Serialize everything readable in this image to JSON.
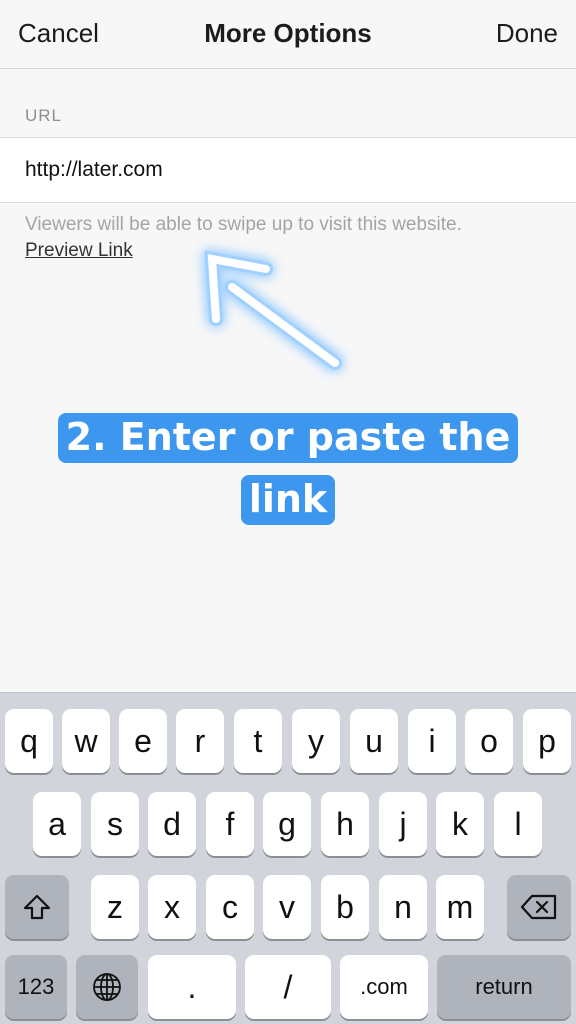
{
  "navbar": {
    "cancel_label": "Cancel",
    "title": "More Options",
    "done_label": "Done"
  },
  "url_section": {
    "header": "URL",
    "value": "http://later.com",
    "footnote": "Viewers will be able to swipe up to visit this website.",
    "preview_link": "Preview Link"
  },
  "overlay": {
    "caption_line1": "2. Enter or paste the",
    "caption_line2": "link",
    "caption_color": "#3d97ee",
    "arrow_icon": "glowing-arrow-icon"
  },
  "keyboard": {
    "row1": [
      "q",
      "w",
      "e",
      "r",
      "t",
      "y",
      "u",
      "i",
      "o",
      "p"
    ],
    "row2": [
      "a",
      "s",
      "d",
      "f",
      "g",
      "h",
      "j",
      "k",
      "l"
    ],
    "row3": [
      "z",
      "x",
      "c",
      "v",
      "b",
      "n",
      "m"
    ],
    "numbers_label": "123",
    "period_label": ".",
    "slash_label": "/",
    "dotcom_label": ".com",
    "return_label": "return",
    "shift_icon": "shift-icon",
    "delete_icon": "delete-icon",
    "globe_icon": "globe-icon"
  }
}
